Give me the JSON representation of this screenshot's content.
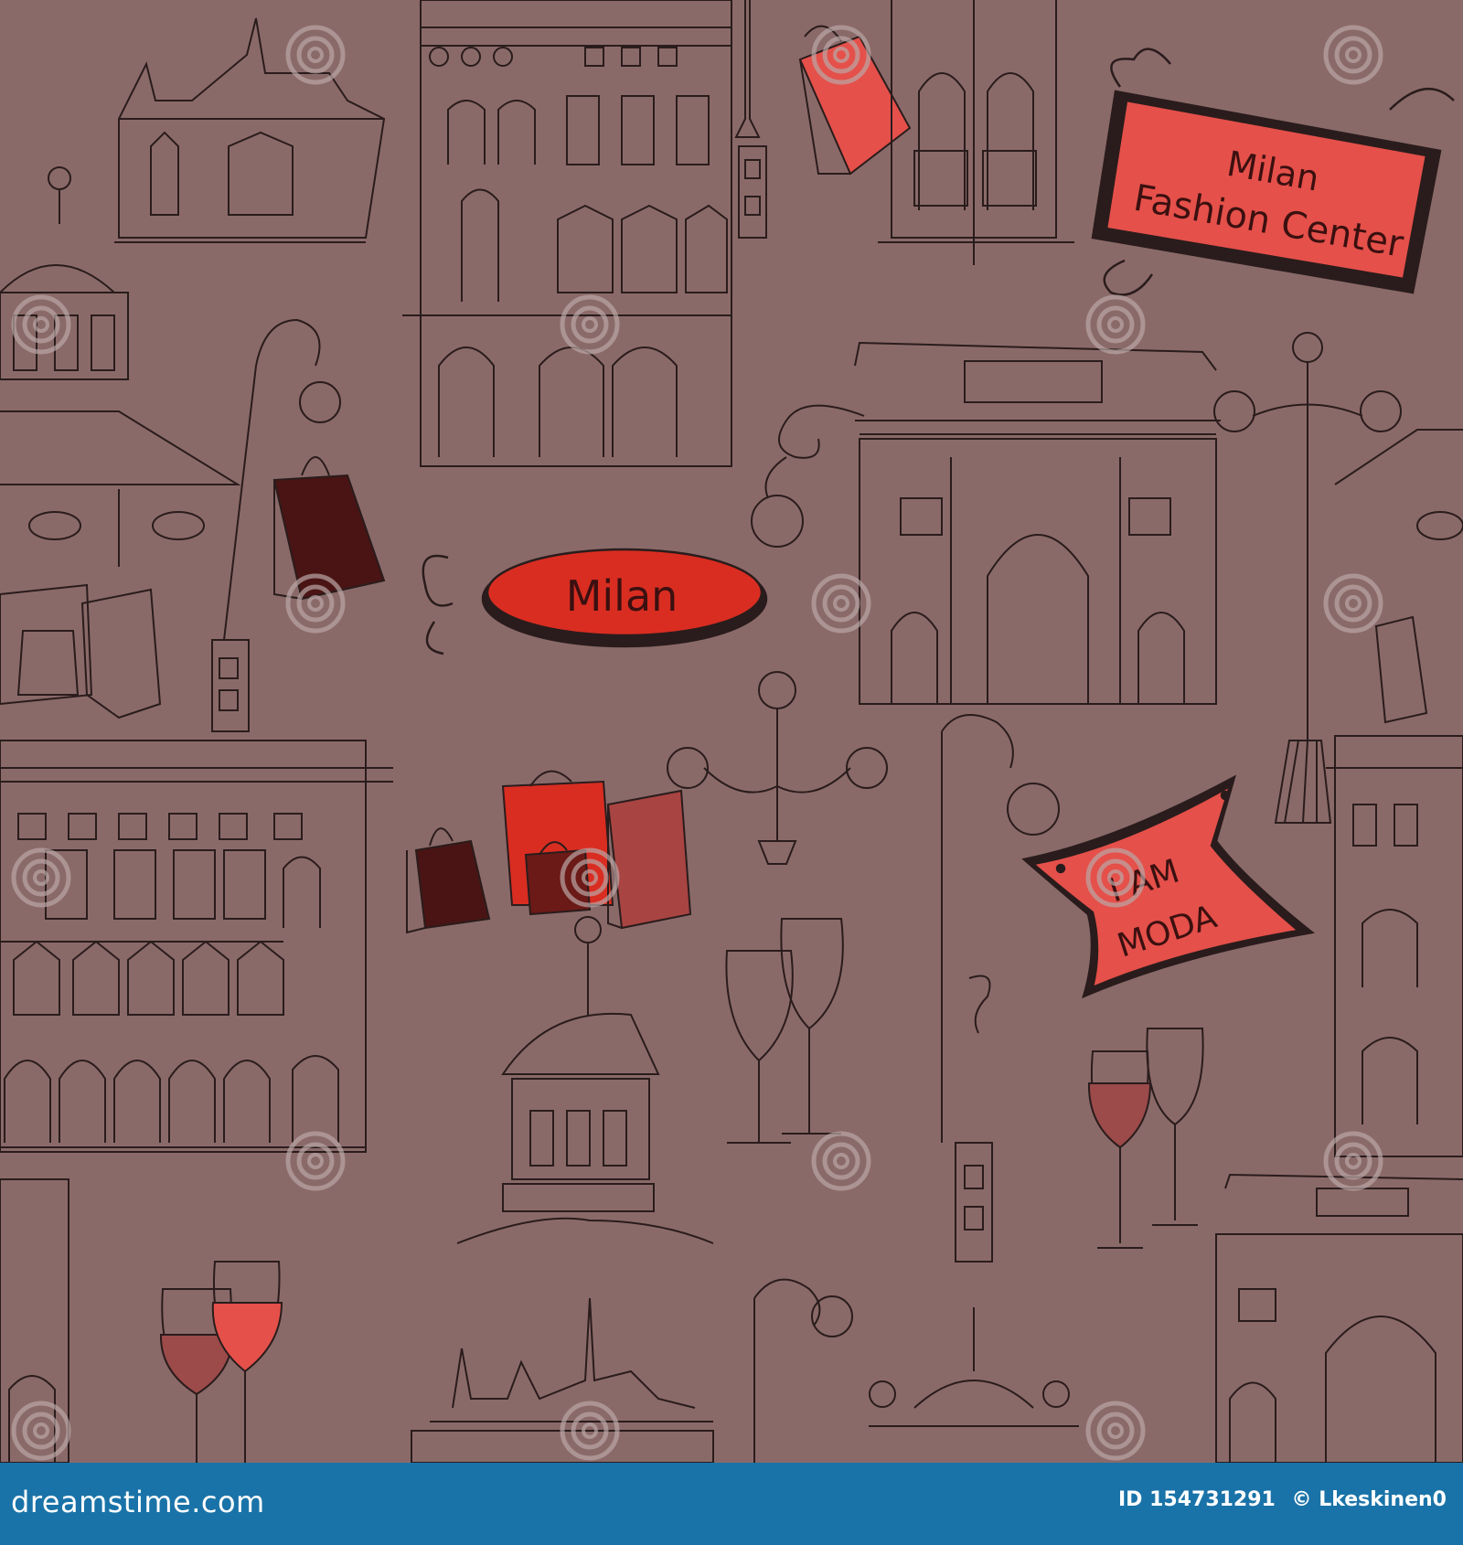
{
  "colors": {
    "background": "#8a6a69",
    "ink": "#2a1c1c",
    "accent_red": "#e5504a",
    "deep_red": "#d92d22",
    "dark_bag": "#4a1414",
    "footer": "#1a73a8",
    "watermark": "#b9a6a5"
  },
  "signs": {
    "fashion_center_line1": "Milan",
    "fashion_center_line2": "Fashion Center",
    "milan_oval": "Milan",
    "moda_line1": "I AM",
    "moda_line2": "MODA"
  },
  "watermark_text": "dreamstime",
  "footer": {
    "site": "dreamstime.com",
    "id_label": "ID 154731291",
    "author": "© Lkeskinen0"
  },
  "icons": [
    "building-icon",
    "street-lamp-icon",
    "shopping-bag-icon",
    "wine-glass-icon",
    "arch-gate-icon",
    "dome-tower-icon",
    "watermark-spiral-icon"
  ]
}
